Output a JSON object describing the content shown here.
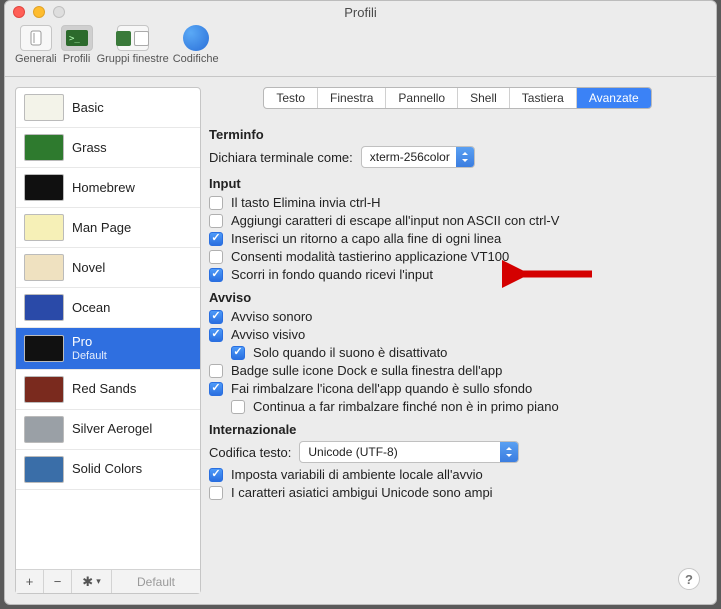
{
  "window": {
    "title": "Profili"
  },
  "toolbar": {
    "items": [
      {
        "label": "Generali"
      },
      {
        "label": "Profili"
      },
      {
        "label": "Gruppi finestre"
      },
      {
        "label": "Codifiche"
      }
    ]
  },
  "sidebar": {
    "items": [
      {
        "label": "Basic"
      },
      {
        "label": "Grass"
      },
      {
        "label": "Homebrew"
      },
      {
        "label": "Man Page"
      },
      {
        "label": "Novel"
      },
      {
        "label": "Ocean"
      },
      {
        "label": "Pro",
        "sub": "Default"
      },
      {
        "label": "Red Sands"
      },
      {
        "label": "Silver Aerogel"
      },
      {
        "label": "Solid Colors"
      }
    ],
    "footer_default": "Default"
  },
  "tabs": {
    "items": [
      {
        "label": "Testo"
      },
      {
        "label": "Finestra"
      },
      {
        "label": "Pannello"
      },
      {
        "label": "Shell"
      },
      {
        "label": "Tastiera"
      },
      {
        "label": "Avanzate"
      }
    ]
  },
  "sections": {
    "terminfo": {
      "title": "Terminfo",
      "declare_label": "Dichiara terminale come:",
      "declare_value": "xterm-256color"
    },
    "input": {
      "title": "Input",
      "opts": [
        {
          "checked": false,
          "label": "Il tasto Elimina invia ctrl-H"
        },
        {
          "checked": false,
          "label": "Aggiungi caratteri di escape all'input non ASCII con ctrl-V"
        },
        {
          "checked": true,
          "label": "Inserisci un ritorno a capo alla fine di ogni linea"
        },
        {
          "checked": false,
          "label": "Consenti modalità tastierino applicazione VT100"
        },
        {
          "checked": true,
          "label": "Scorri in fondo quando ricevi l'input"
        }
      ]
    },
    "avviso": {
      "title": "Avviso",
      "opts": [
        {
          "checked": true,
          "label": "Avviso sonoro"
        },
        {
          "checked": true,
          "label": "Avviso visivo"
        },
        {
          "checked": true,
          "label": "Solo quando il suono è disattivato",
          "indent": true
        },
        {
          "checked": false,
          "label": "Badge sulle icone Dock e sulla finestra dell'app"
        },
        {
          "checked": true,
          "label": "Fai rimbalzare l'icona dell'app quando è sullo sfondo"
        },
        {
          "checked": false,
          "label": "Continua a far rimbalzare finché non è in primo piano",
          "indent": true
        }
      ]
    },
    "intl": {
      "title": "Internazionale",
      "encoding_label": "Codifica testo:",
      "encoding_value": "Unicode (UTF-8)",
      "opts": [
        {
          "checked": true,
          "label": "Imposta variabili di ambiente locale all'avvio"
        },
        {
          "checked": false,
          "label": "I caratteri asiatici ambigui Unicode sono ampi"
        }
      ]
    }
  },
  "thumb_colors": {
    "Basic": "#f3f3e9",
    "Grass": "#2e7a2e",
    "Homebrew": "#101010",
    "Man Page": "#f6f0b7",
    "Novel": "#efe1c0",
    "Ocean": "#2a4aa8",
    "Pro": "#111111",
    "Red Sands": "#7a2a1e",
    "Silver Aerogel": "#9aa0a6",
    "Solid Colors": "#3a6ea8"
  }
}
